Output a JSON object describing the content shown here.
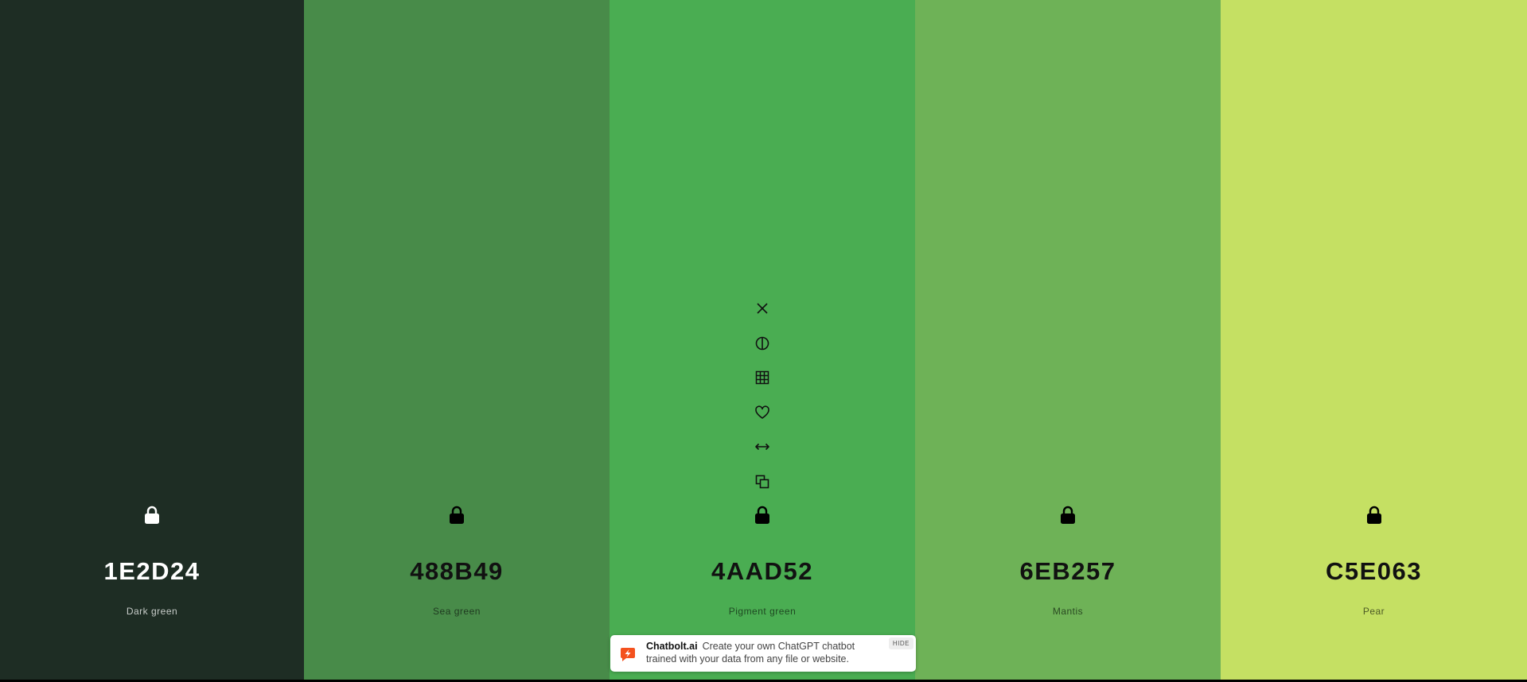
{
  "palette": {
    "colors": [
      {
        "hex": "1E2D24",
        "name": "Dark green",
        "bg": "#1E2D24",
        "text": "#ffffff",
        "sub": "#c7ccc9"
      },
      {
        "hex": "488B49",
        "name": "Sea green",
        "bg": "#488B49",
        "text": "#111111",
        "sub": "#1f3a20"
      },
      {
        "hex": "4AAD52",
        "name": "Pigment green",
        "bg": "#4AAD52",
        "text": "#111111",
        "sub": "#1f4a22"
      },
      {
        "hex": "6EB257",
        "name": "Mantis",
        "bg": "#6EB257",
        "text": "#111111",
        "sub": "#2a4a22"
      },
      {
        "hex": "C5E063",
        "name": "Pear",
        "bg": "#C5E063",
        "text": "#111111",
        "sub": "#4d5a26"
      }
    ],
    "hovered_tools": [
      "remove-icon",
      "contrast-icon",
      "shades-icon",
      "favorite-icon",
      "drag-icon",
      "copy-icon",
      "lock-icon"
    ]
  },
  "ad": {
    "brand": "Chatbolt.ai",
    "text": "Create your own ChatGPT chatbot trained with your data from any file or website.",
    "hide_label": "HIDE",
    "logo_color": "#F4511E"
  }
}
